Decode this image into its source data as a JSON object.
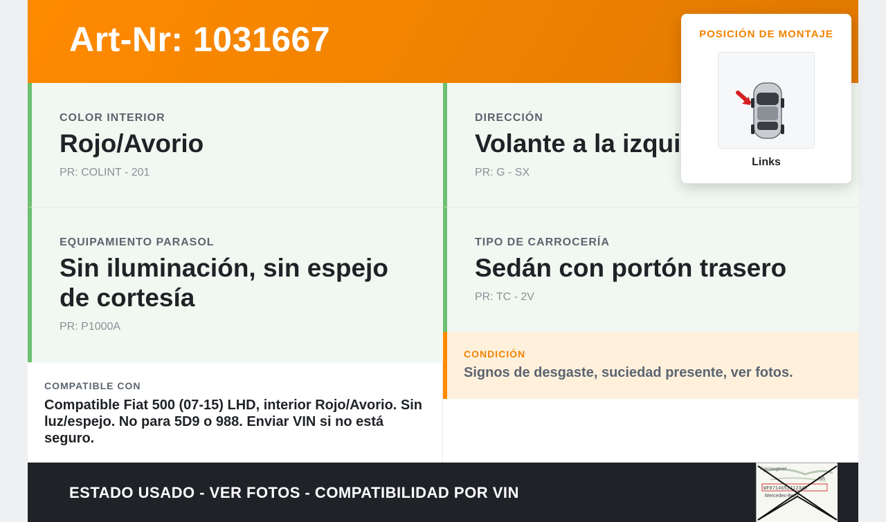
{
  "header": {
    "title": "Art-Nr: 1031667"
  },
  "fields": {
    "interior_color": {
      "label": "COLOR INTERIOR",
      "value": "Rojo/Avorio",
      "pr": "PR: COLINT - 201"
    },
    "steering": {
      "label": "DIRECCIÓN",
      "value": "Volante a la izquierda",
      "pr": "PR: G - SX"
    },
    "sun_visor": {
      "label": "EQUIPAMIENTO PARASOL",
      "value": "Sin iluminación, sin espejo de cortesía",
      "pr": "PR: P1000A"
    },
    "body_type": {
      "label": "TIPO DE CARROCERÍA",
      "value": "Sedán con portón trasero",
      "pr": "PR: TC - 2V"
    }
  },
  "condition": {
    "label": "CONDICIÓN",
    "text": "Signos de desgaste, suciedad presente, ver fotos."
  },
  "compatible": {
    "label": "COMPATIBLE CON",
    "text": "Compatible Fiat 500 (07-15) LHD, interior Rojo/Avorio. Sin luz/espejo. No para 5D9 o 988. Enviar VIN si no está seguro."
  },
  "footer": {
    "text": "ESTADO USADO - VER FOTOS - COMPATIBILIDAD POR VIN"
  },
  "mounting_popup": {
    "title": "POSICIÓN DE MONTAJE",
    "caption": "Links",
    "icon": "car-top-view-left-arrow-icon"
  },
  "stamp": {
    "icon": "registration-document-thumbnail",
    "lines": [
      "Fahrzeugbrief",
      "WF0714652J12345",
      "Mercedes-Benz",
      "AiA"
    ]
  },
  "colors": {
    "accent": "#ff8a00",
    "green": "#6cc070",
    "cell_bg": "#f1f8f1",
    "condition_bg": "#fff0dc",
    "footer_bg": "#1f2226"
  }
}
